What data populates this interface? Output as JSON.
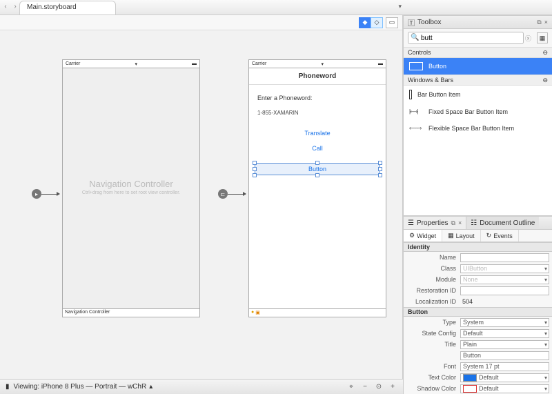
{
  "tab": {
    "title": "Main.storyboard"
  },
  "canvas": {
    "nav_controller": {
      "carrier": "Carrier",
      "title": "Navigation Controller",
      "subtitle": "Ctrl+drag from here to set root view controller.",
      "footer": "Navigation Controller"
    },
    "view_controller": {
      "carrier": "Carrier",
      "title": "Phoneword",
      "label": "Enter a Phoneword:",
      "input_value": "1-855-XAMARIN",
      "btn_translate": "Translate",
      "btn_call": "Call",
      "btn_selected": "Button"
    }
  },
  "statusbar": {
    "viewing": "Viewing: iPhone 8 Plus — Portrait — wChR"
  },
  "toolbox": {
    "title": "Toolbox",
    "search_value": "butt",
    "groups": {
      "controls": "Controls",
      "windows_bars": "Windows & Bars"
    },
    "items": {
      "button": "Button",
      "bar_button": "Bar Button Item",
      "fixed_space": "Fixed Space Bar Button Item",
      "flexible_space": "Flexible Space Bar Button Item"
    }
  },
  "properties": {
    "title": "Properties",
    "outline_title": "Document Outline",
    "tabs": {
      "widget": "Widget",
      "layout": "Layout",
      "events": "Events"
    },
    "sections": {
      "identity": "Identity",
      "button": "Button"
    },
    "identity": {
      "name_label": "Name",
      "name_value": "",
      "class_label": "Class",
      "class_value": "UIButton",
      "module_label": "Module",
      "module_value": "None",
      "restoration_label": "Restoration ID",
      "restoration_value": "",
      "localization_label": "Localization ID",
      "localization_value": "504"
    },
    "button": {
      "type_label": "Type",
      "type_value": "System",
      "state_label": "State Config",
      "state_value": "Default",
      "title_label": "Title",
      "title_value": "Plain",
      "title_text_value": "Button",
      "font_label": "Font",
      "font_value": "System 17 pt",
      "text_color_label": "Text Color",
      "text_color_value": "Default",
      "text_color_swatch": "#1a73e8",
      "shadow_color_label": "Shadow Color",
      "shadow_color_value": "Default",
      "shadow_color_swatch": "#ffffff"
    }
  }
}
